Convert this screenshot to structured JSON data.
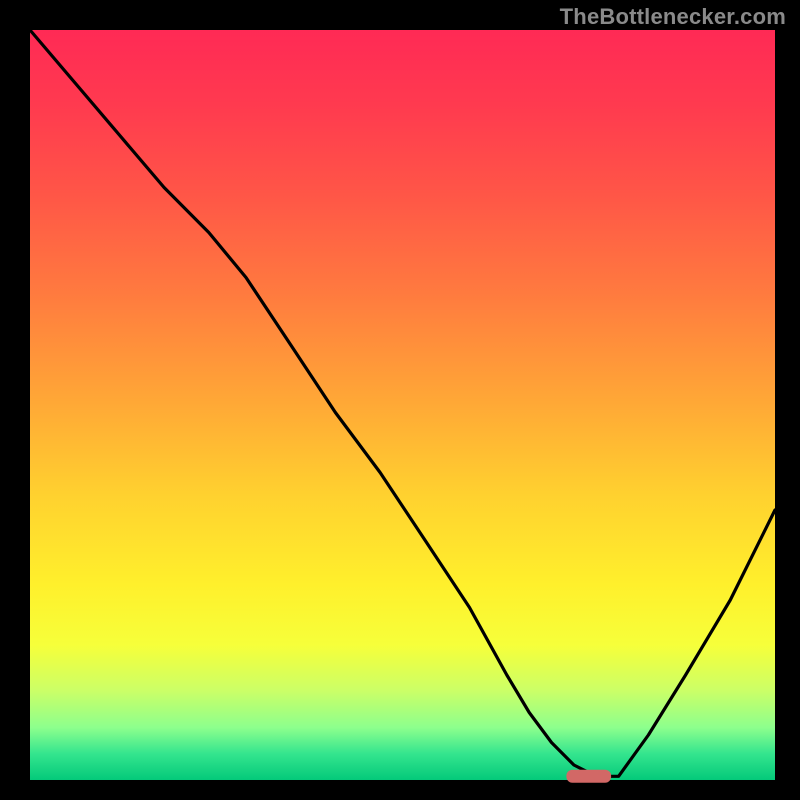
{
  "watermark": "TheBottleneсker.com",
  "plot": {
    "outer_width": 800,
    "outer_height": 800,
    "inner_x": 30,
    "inner_y": 30,
    "inner_w": 745,
    "inner_h": 750
  },
  "colors": {
    "frame": "#000000",
    "curve": "#000000",
    "watermark": "#8a8a8a",
    "marker": "#d26866"
  },
  "gradient_stops": [
    {
      "offset": 0.0,
      "color": "#ff2a55"
    },
    {
      "offset": 0.1,
      "color": "#ff3a4f"
    },
    {
      "offset": 0.22,
      "color": "#ff5647"
    },
    {
      "offset": 0.35,
      "color": "#ff7a3f"
    },
    {
      "offset": 0.5,
      "color": "#ffa936"
    },
    {
      "offset": 0.62,
      "color": "#ffd12f"
    },
    {
      "offset": 0.74,
      "color": "#fff02c"
    },
    {
      "offset": 0.82,
      "color": "#f6ff3a"
    },
    {
      "offset": 0.88,
      "color": "#ccff66"
    },
    {
      "offset": 0.93,
      "color": "#8dff8d"
    },
    {
      "offset": 0.965,
      "color": "#34e58e"
    },
    {
      "offset": 1.0,
      "color": "#04c97a"
    }
  ],
  "chart_data": {
    "type": "line",
    "title": "",
    "xlabel": "",
    "ylabel": "",
    "xlim": [
      0,
      100
    ],
    "ylim": [
      0,
      100
    ],
    "x": [
      0,
      6,
      12,
      18,
      24,
      29,
      35,
      41,
      47,
      53,
      59,
      64,
      67,
      70,
      73,
      76,
      79,
      83,
      88,
      94,
      100
    ],
    "values": [
      100,
      93,
      86,
      79,
      73,
      67,
      58,
      49,
      41,
      32,
      23,
      14,
      9,
      5,
      2,
      0.5,
      0.5,
      6,
      14,
      24,
      36
    ],
    "marker": {
      "x_range": [
        72,
        78
      ],
      "y": 0.5
    }
  }
}
